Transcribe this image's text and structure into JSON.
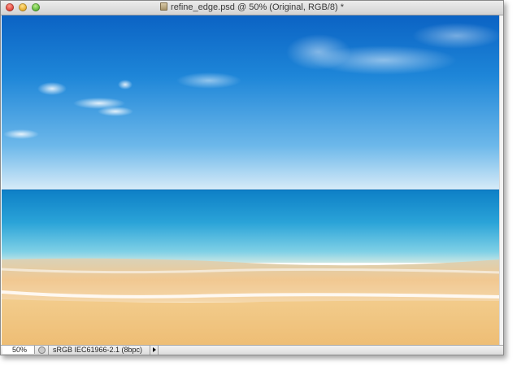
{
  "window": {
    "title": "refine_edge.psd @ 50% (Original, RGB/8) *",
    "doc_icon": "photoshop-document-icon"
  },
  "traffic_lights": {
    "close_color": "#e0443a",
    "minimize_color": "#e7ad2c",
    "zoom_color": "#5eb93a"
  },
  "status_bar": {
    "zoom_value": "50%",
    "doc_profile": "sRGB IEC61966-2.1 (8bpc)"
  },
  "colors": {
    "sky_top": "#0d6fcf",
    "sky_horizon": "#d9ecf8",
    "sea_deep": "#1f8fd2",
    "sea_shallow": "#5fc6e0",
    "sand": "#efc27a"
  }
}
